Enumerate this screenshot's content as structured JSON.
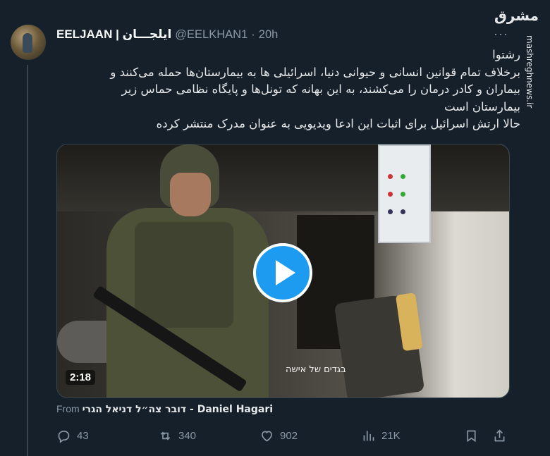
{
  "tweet": {
    "author_name": "EELJAAN | ایلجـــان",
    "handle": "@EELKHAN1",
    "separator": "·",
    "time": "20h",
    "more_label": "···",
    "text_lines": [
      "رشتوا",
      "برخلاف تمام قوانین انسانی و حیوانی دنیا، اسرائیلی ها به بیمارستان‌ها حمله می‌کنند و",
      "بیماران و کادر درمان را می‌کشند، به این بهانه که تونل‌ها و پایگاه نظامی حماس زیر",
      "بیمارستان است",
      "حالا ارتش اسرائیل برای اثبات این ادعا ویدیویی به عنوان مدرک منتشر کرده"
    ]
  },
  "watermark": {
    "logo_text": "مشرق",
    "site_text": "mashreghnews.ir"
  },
  "media": {
    "overlay_caption": "בגדים של אישה",
    "duration": "2:18",
    "play_icon": "play-icon"
  },
  "source": {
    "prefix": "From",
    "name": "דובר צה״ל דניאל הגרי - Daniel Hagari"
  },
  "actions": {
    "reply_count": "43",
    "retweet_count": "340",
    "like_count": "902",
    "views_count": "21K"
  },
  "colors": {
    "background": "#15202b",
    "accent": "#1d9bf0",
    "muted": "#8b98a5"
  }
}
